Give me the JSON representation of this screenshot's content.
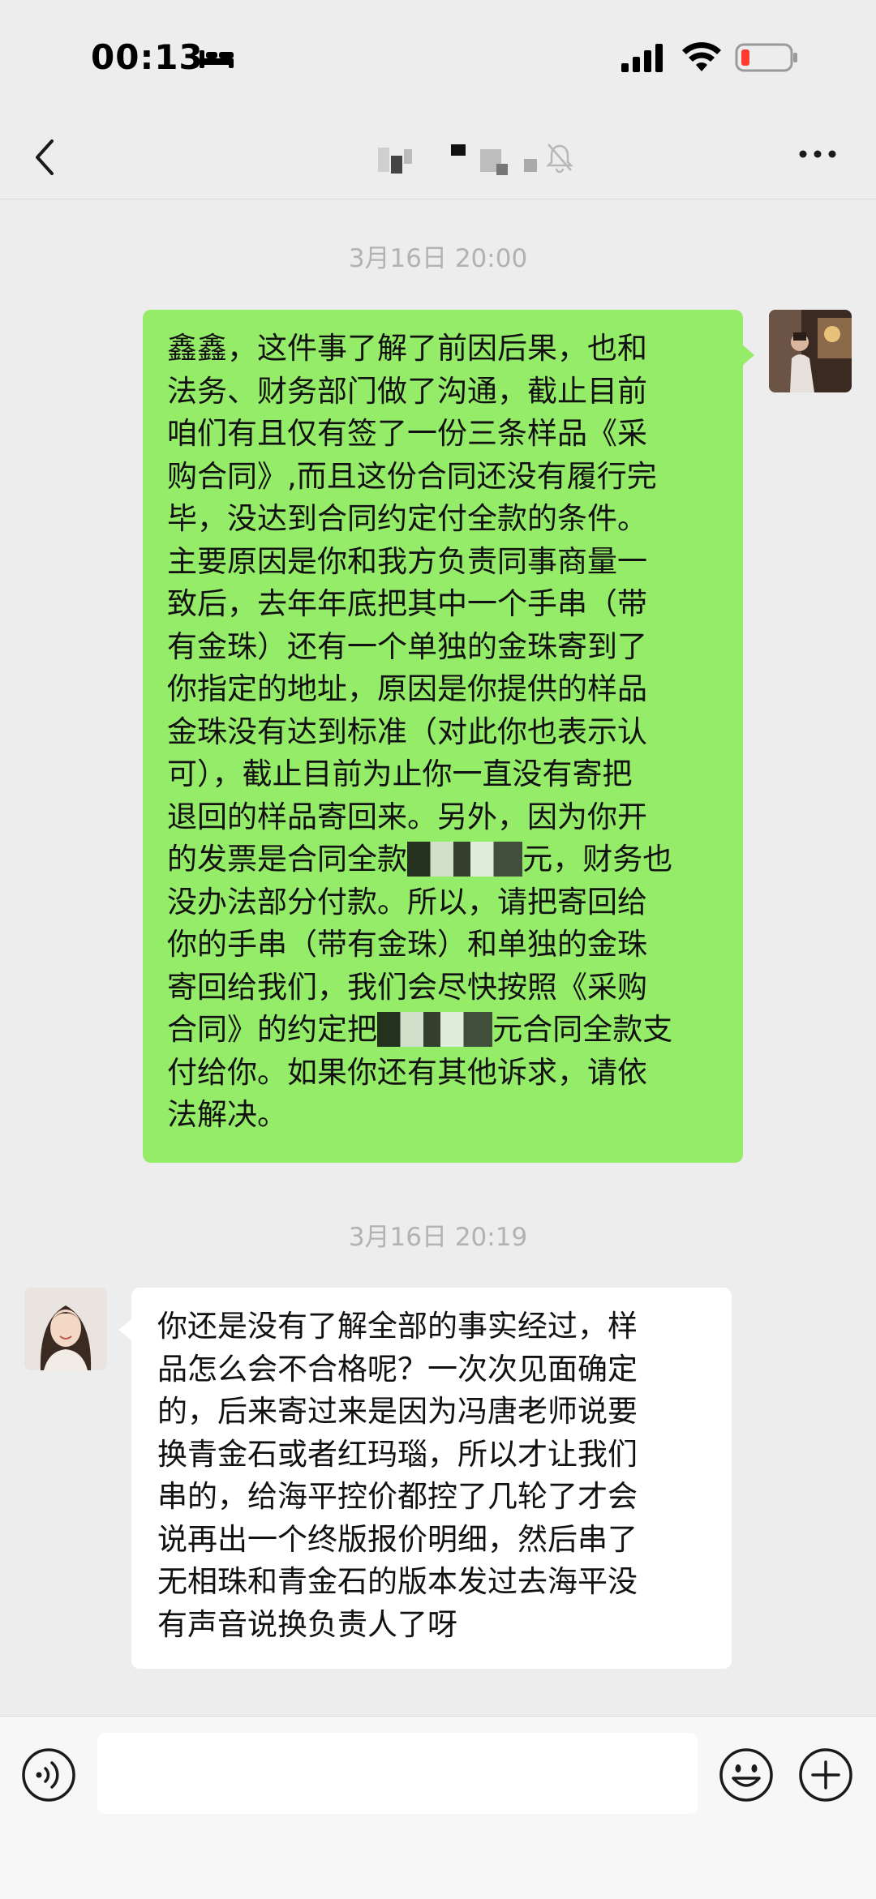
{
  "status_bar": {
    "time": "00:13",
    "icons": [
      "sleep-mode-icon",
      "signal-icon",
      "wifi-icon",
      "battery-low-icon"
    ],
    "battery_color": "#ff3b30"
  },
  "nav_bar": {
    "back_icon": "chevron-left-icon",
    "contact_name": "",
    "mute_icon": "bell-slash-icon",
    "more_icon": "ellipsis-icon"
  },
  "colors": {
    "background": "#ededed",
    "outgoing_bubble": "#95ec69",
    "incoming_bubble": "#ffffff",
    "timestamp": "#b2b2b2"
  },
  "messages": [
    {
      "timestamp": "3月16日 20:00",
      "direction": "outgoing",
      "lines": [
        "鑫鑫，这件事了解了前因后果，也和",
        "法务、财务部门做了沟通，截止目前",
        "咱们有且仅有签了一份三条样品《采",
        "购合同》,而且这份合同还没有履行完",
        "毕，没达到合同约定付全款的条件。",
        "主要原因是你和我方负责同事商量一",
        "致后，去年年底把其中一个手串（带",
        "有金珠）还有一个单独的金珠寄到了",
        "你指定的地址，原因是你提供的样品",
        "金珠没有达到标准（对此你也表示认",
        "可），截止目前为止你一直没有寄把",
        "退回的样品寄回来。另外，因为你开"
      ],
      "line13_before": "的发票是合同全款",
      "line13_after": "元，财务也",
      "lines_mid": [
        "没办法部分付款。所以，请把寄回给",
        "你的手串（带有金珠）和单独的金珠",
        "寄回给我们，我们会尽快按照《采购"
      ],
      "line17_before": "合同》的约定把",
      "line17_after": "元合同全款支",
      "lines_end": [
        "付给你。如果你还有其他诉求，请依",
        "法解决。"
      ]
    },
    {
      "timestamp": "3月16日 20:19",
      "direction": "incoming",
      "lines": [
        "你还是没有了解全部的事实经过，样",
        "品怎么会不合格呢？一次次见面确定",
        "的，后来寄过来是因为冯唐老师说要",
        "换青金石或者红玛瑙，所以才让我们",
        "串的，给海平控价都控了几轮了才会",
        "说再出一个终版报价明细，然后串了",
        "无相珠和青金石的版本发过去海平没",
        "有声音说换负责人了呀"
      ]
    }
  ],
  "input_bar": {
    "voice_icon": "voice-input-icon",
    "input_value": "",
    "emoji_icon": "emoji-icon",
    "plus_icon": "plus-icon"
  }
}
